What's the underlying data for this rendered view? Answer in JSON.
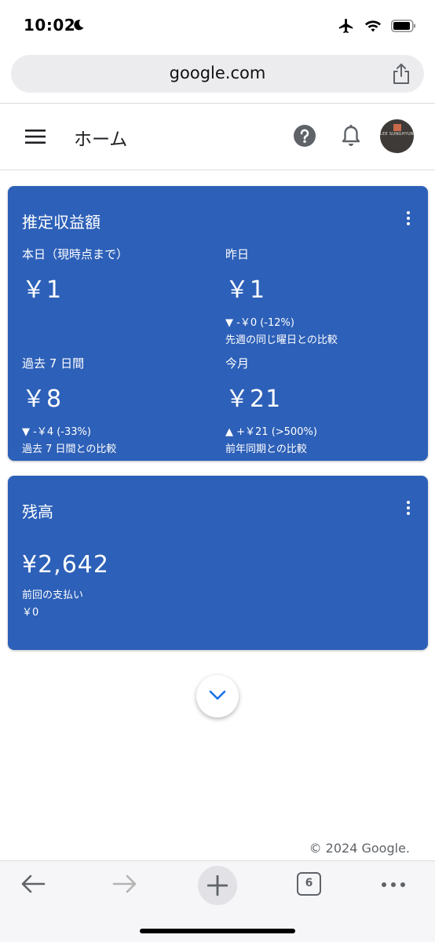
{
  "status_bar": {
    "time": "10:02",
    "icons": [
      "moon-icon",
      "airplane-icon",
      "wifi-icon",
      "battery-icon"
    ]
  },
  "browser": {
    "url": "google.com",
    "tab_count": "6"
  },
  "header": {
    "title": "ホーム",
    "avatar_text": "LEE SUNGHYUN"
  },
  "earnings_card": {
    "title": "推定収益額",
    "metrics": [
      {
        "label": "本日（現時点まで）",
        "value": "￥1",
        "change": "",
        "compare": ""
      },
      {
        "label": "昨日",
        "value": "￥1",
        "change": "▼ -￥0 (-12%)",
        "compare": "先週の同じ曜日との比較"
      },
      {
        "label": "過去 7 日間",
        "value": "￥8",
        "change": "▼ -￥4 (-33%)",
        "compare": "過去 7 日間との比較"
      },
      {
        "label": "今月",
        "value": "￥21",
        "change": "▲ +￥21 (>500%)",
        "compare": "前年同期との比較"
      }
    ]
  },
  "balance_card": {
    "title": "残高",
    "value": "¥2,642",
    "last_payment_label": "前回の支払い",
    "last_payment_value": "￥0"
  },
  "footer": {
    "copyright": "© 2024 Google."
  },
  "colors": {
    "card_blue": "#2d60b8",
    "accent_blue": "#1a73e8",
    "icon_gray": "#5f6368"
  }
}
